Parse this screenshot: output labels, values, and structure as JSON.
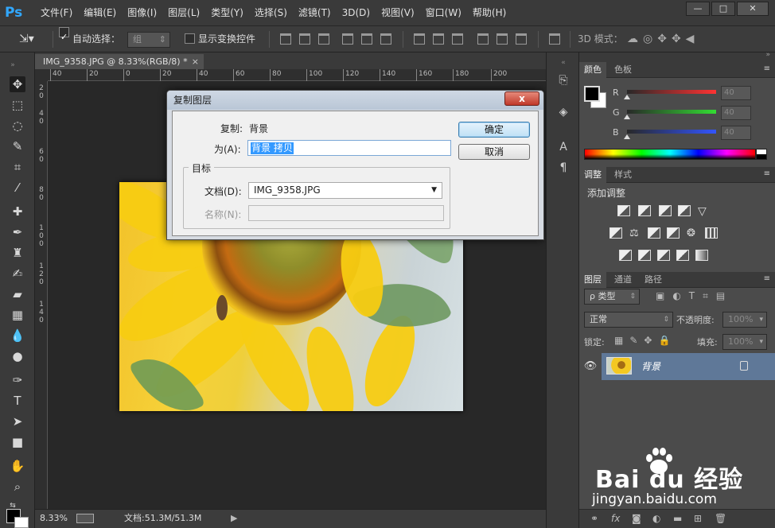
{
  "app": {
    "logo": "Ps",
    "window_controls": [
      "—",
      "□",
      "✕"
    ]
  },
  "menu": [
    "文件(F)",
    "编辑(E)",
    "图像(I)",
    "图层(L)",
    "类型(Y)",
    "选择(S)",
    "滤镜(T)",
    "3D(D)",
    "视图(V)",
    "窗口(W)",
    "帮助(H)"
  ],
  "options": {
    "auto_select_label": "自动选择：",
    "auto_select_value": "组",
    "transform_controls_label": "显示变换控件",
    "mode_3d_label": "3D 模式："
  },
  "document": {
    "tab_title": "IMG_9358.JPG @ 8.33%(RGB/8) *",
    "tab_close": "×",
    "ruler_top": [
      "40",
      "20",
      "0",
      "20",
      "40",
      "60",
      "80",
      "100",
      "120",
      "140",
      "160",
      "180",
      "200"
    ],
    "ruler_left": [
      "2",
      "0",
      "4",
      "0",
      "6",
      "0",
      "8",
      "0",
      "1",
      "0",
      "0",
      "1",
      "2",
      "0",
      "1",
      "4",
      "0"
    ]
  },
  "status": {
    "zoom": "8.33%",
    "doc_info": "文档:51.3M/51.3M",
    "arrow": "▶"
  },
  "panels": {
    "color": {
      "tabs": [
        "颜色",
        "色板"
      ],
      "channels": [
        {
          "label": "R",
          "value": "40",
          "gradient_color": "#ff3333"
        },
        {
          "label": "G",
          "value": "40",
          "gradient_color": "#33dd33"
        },
        {
          "label": "B",
          "value": "40",
          "gradient_color": "#3355ff"
        }
      ]
    },
    "adjustments": {
      "tabs": [
        "调整",
        "样式"
      ],
      "title": "添加调整"
    },
    "layers": {
      "tabs": [
        "图层",
        "通道",
        "路径"
      ],
      "filter": "ρ 类型",
      "blend_mode": "正常",
      "opacity_label": "不透明度:",
      "opacity_value": "100%",
      "lock_label": "锁定:",
      "fill_label": "填充:",
      "fill_value": "100%",
      "layer_name": "背景"
    }
  },
  "dialog": {
    "title": "复制图层",
    "copy_label": "复制:",
    "copy_value": "背景",
    "as_label": "为(A):",
    "as_value": "背景 拷贝",
    "target_group": "目标",
    "document_label": "文档(D):",
    "document_value": "IMG_9358.JPG",
    "name_label": "名称(N):",
    "name_value": "",
    "ok_button": "确定",
    "cancel_button": "取消",
    "close_button": "x"
  },
  "watermark": {
    "brand": "Bai du 经验",
    "site": "jingyan.baidu.com"
  }
}
